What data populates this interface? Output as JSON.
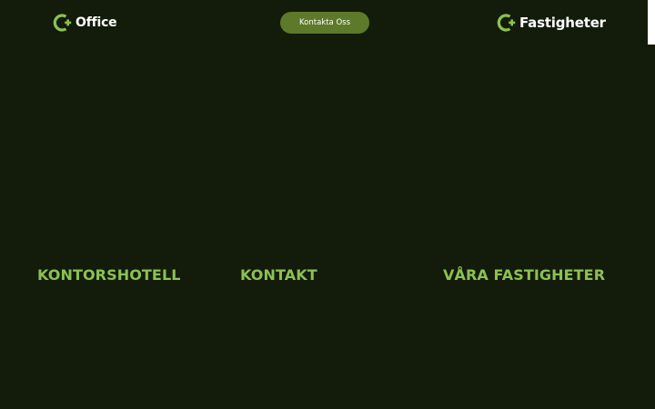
{
  "header": {
    "left_brand": {
      "name": "Office",
      "icon": "c-plus-logo-icon"
    },
    "cta_label": "Kontakta Oss",
    "right_brand": {
      "name": "Fastigheter",
      "icon": "c-plus-logo-icon"
    }
  },
  "sections": [
    {
      "title": "KONTORSHOTELL"
    },
    {
      "title": "KONTAKT"
    },
    {
      "title": "VÅRA FASTIGHETER"
    }
  ],
  "colors": {
    "background": "#131b0a",
    "accent": "#8cc152",
    "button": "#5c7a2a",
    "text": "#ffffff"
  }
}
